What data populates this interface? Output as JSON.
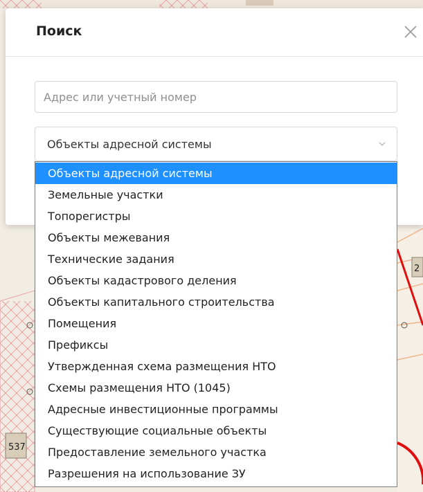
{
  "dialog": {
    "title": "Поиск",
    "close_icon": "close-icon",
    "search_input": {
      "value": "",
      "placeholder": "Адрес или учетный номер"
    },
    "object_type_select": {
      "selected_value": "Объекты адресной системы",
      "chevron_icon": "chevron-down-icon"
    }
  },
  "dropdown": {
    "selected_index": 0,
    "options": [
      "Объекты адресной системы",
      "Земельные участки",
      "Топорегистры",
      "Объекты межевания",
      "Технические задания",
      "Объекты кадастрового деления",
      "Объекты капитального строительства",
      "Помещения",
      "Префиксы",
      "Утвержденная схема размещения НТО",
      "Схемы размещения НТО (1045)",
      "Адресные инвестиционные программы",
      "Существующие социальные объекты",
      "Предоставление земельного участка",
      "Разрешения на использование ЗУ"
    ]
  },
  "map": {
    "labels": [
      "537",
      "2"
    ]
  },
  "colors": {
    "selected_item_bg": "#1e90ff",
    "selected_item_text": "#ffffff",
    "map_hatch": "#e9a3a3",
    "map_red_line": "#e10e0e"
  }
}
